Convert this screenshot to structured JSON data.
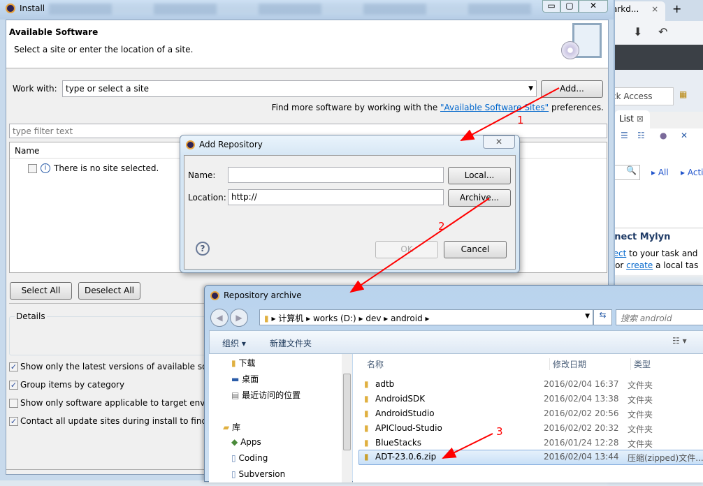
{
  "browser": {
    "tab_label": "arkd...",
    "tab_close": "×",
    "new_tab": "+",
    "quick_access": "ck Access",
    "list_tab": "List",
    "list_close": "⊠",
    "filter_all": "All",
    "filter_active": "Acti",
    "mylyn_title": "nnect Mylyn",
    "mylyn_line1_link": "nect",
    "mylyn_line1_rest": " to your task and",
    "mylyn_line2_pre": "s or ",
    "mylyn_line2_link": "create",
    "mylyn_line2_rest": " a local tas"
  },
  "install": {
    "title": "Install",
    "header_title": "Available Software",
    "header_desc": "Select a site or enter the location of a site.",
    "work_with_label": "Work with:",
    "work_with_value": "type or select a site",
    "add_button": "Add...",
    "find_more_pre": "Find more software by working with the ",
    "find_more_link": "\"Available Software Sites\"",
    "find_more_post": " preferences.",
    "filter_placeholder": "type filter text",
    "table_header_name": "Name",
    "table_message": "There is no site selected.",
    "select_all": "Select All",
    "deselect_all": "Deselect All",
    "details_label": "Details",
    "options": [
      {
        "label": "Show only the latest versions of available soft",
        "checked": true
      },
      {
        "label": "Group items by category",
        "checked": true
      },
      {
        "label": "Show only software applicable to target envir",
        "checked": false
      },
      {
        "label": "Contact all update sites during install to find r",
        "checked": true
      }
    ]
  },
  "add_repo": {
    "title": "Add Repository",
    "name_label": "Name:",
    "name_value": "",
    "location_label": "Location:",
    "location_value": "http://",
    "local_button": "Local...",
    "archive_button": "Archive...",
    "ok_button": "OK",
    "cancel_button": "Cancel"
  },
  "archive": {
    "title": "Repository archive",
    "breadcrumb": [
      "计算机",
      "works (D:)",
      "dev",
      "android"
    ],
    "search_placeholder": "搜索 android",
    "organize": "组织 ▾",
    "new_folder": "新建文件夹",
    "nav": [
      {
        "label": "下载",
        "icon": "download-folder-icon"
      },
      {
        "label": "桌面",
        "icon": "desktop-icon"
      },
      {
        "label": "最近访问的位置",
        "icon": "recent-places-icon"
      },
      {
        "label": "库",
        "icon": "library-icon"
      },
      {
        "label": "Apps",
        "icon": "apps-icon"
      },
      {
        "label": "Coding",
        "icon": "document-icon"
      },
      {
        "label": "Subversion",
        "icon": "document-icon"
      }
    ],
    "columns": [
      "名称",
      "修改日期",
      "类型"
    ],
    "files": [
      {
        "name": "adtb",
        "date": "2016/02/04 16:37",
        "type": "文件夹"
      },
      {
        "name": "AndroidSDK",
        "date": "2016/02/04 13:38",
        "type": "文件夹"
      },
      {
        "name": "AndroidStudio",
        "date": "2016/02/02 20:56",
        "type": "文件夹"
      },
      {
        "name": "APICloud-Studio",
        "date": "2016/02/02 20:32",
        "type": "文件夹"
      },
      {
        "name": "BlueStacks",
        "date": "2016/01/24 12:28",
        "type": "文件夹"
      },
      {
        "name": "ADT-23.0.6.zip",
        "date": "2016/02/04 13:44",
        "type": "压缩(zipped)文件...",
        "selected": true
      }
    ]
  },
  "annotations": [
    "1",
    "2",
    "3"
  ],
  "colors": {
    "accent": "#0066cc",
    "annotation": "#ff0000",
    "selection": "#cce4f7"
  }
}
